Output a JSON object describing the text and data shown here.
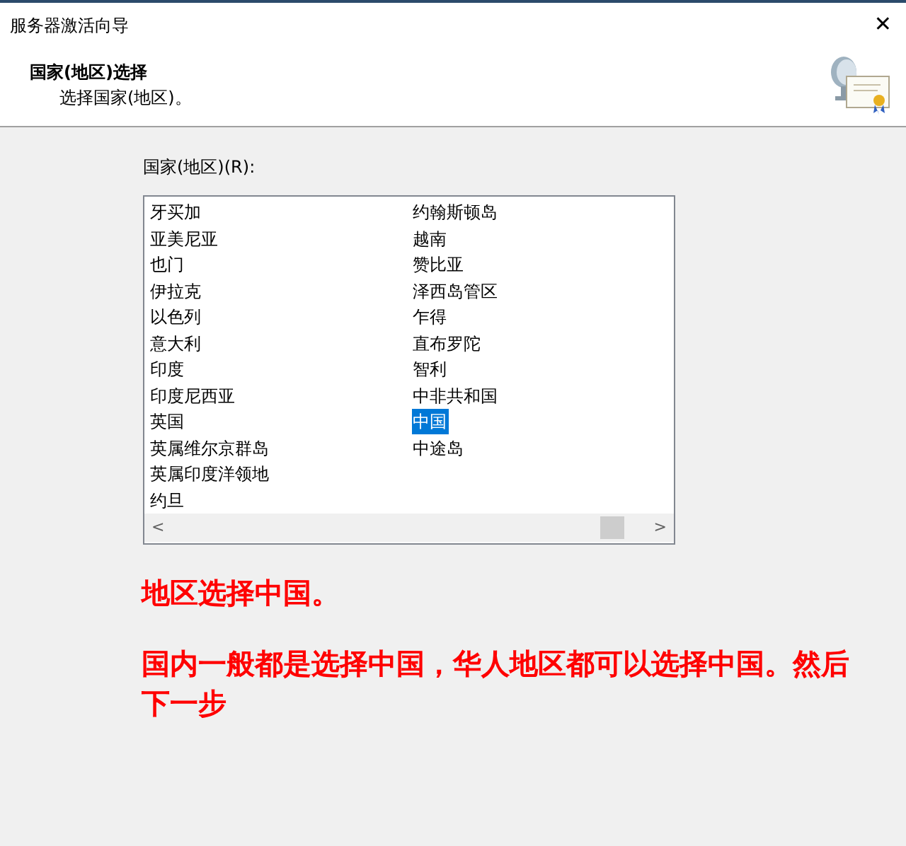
{
  "window": {
    "title": "服务器激活向导",
    "close": "✕"
  },
  "header": {
    "title": "国家(地区)选择",
    "subtitle": "选择国家(地区)。"
  },
  "country_list": {
    "label": "国家(地区)(R):",
    "scroll_left": "<",
    "scroll_right": ">",
    "items": [
      {
        "label": "牙买加",
        "selected": false
      },
      {
        "label": "亚美尼亚",
        "selected": false
      },
      {
        "label": "也门",
        "selected": false
      },
      {
        "label": "伊拉克",
        "selected": false
      },
      {
        "label": "以色列",
        "selected": false
      },
      {
        "label": "意大利",
        "selected": false
      },
      {
        "label": "印度",
        "selected": false
      },
      {
        "label": "印度尼西亚",
        "selected": false
      },
      {
        "label": "英国",
        "selected": false
      },
      {
        "label": "英属维尔京群岛",
        "selected": false
      },
      {
        "label": "英属印度洋领地",
        "selected": false
      },
      {
        "label": "约旦",
        "selected": false
      },
      {
        "label": "约翰斯顿岛",
        "selected": false
      },
      {
        "label": "越南",
        "selected": false
      },
      {
        "label": "赞比亚",
        "selected": false
      },
      {
        "label": "泽西岛管区",
        "selected": false
      },
      {
        "label": "乍得",
        "selected": false
      },
      {
        "label": "直布罗陀",
        "selected": false
      },
      {
        "label": "智利",
        "selected": false
      },
      {
        "label": "中非共和国",
        "selected": false
      },
      {
        "label": "中国",
        "selected": true
      },
      {
        "label": "中途岛",
        "selected": false
      }
    ]
  },
  "annotations": [
    "地区选择中国。",
    "国内一般都是选择中国，华人地区都可以选择中国。然后下一步"
  ]
}
